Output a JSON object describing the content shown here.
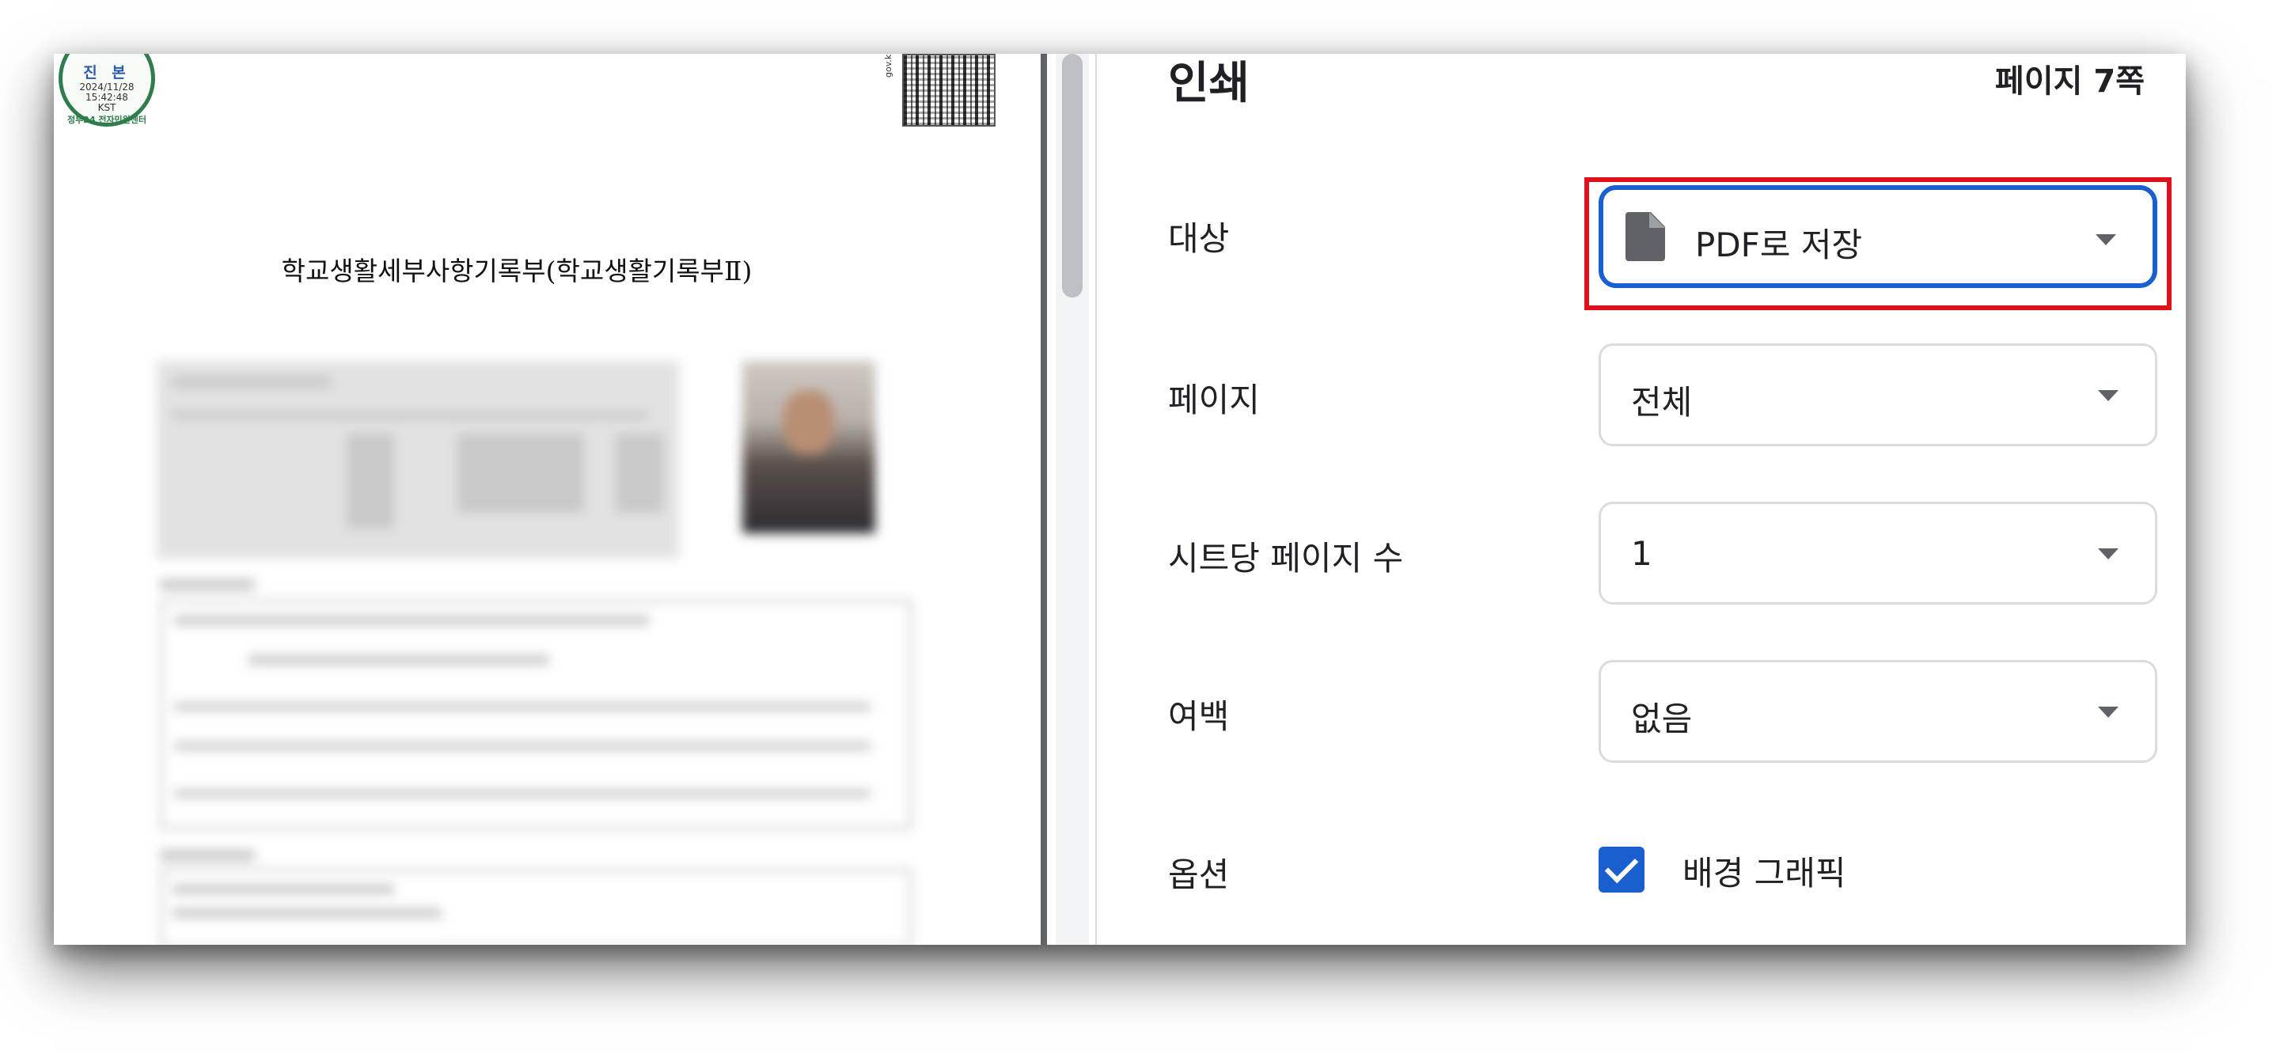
{
  "preview": {
    "seal": {
      "title": "진 본",
      "date": "2024/11/28",
      "time": "15:42:48",
      "tz": "KST",
      "org": "정부24 전자민원센터"
    },
    "qr_label": "gov.kr",
    "doc_title": "학교생활세부사항기록부(학교생활기록부Ⅱ)"
  },
  "settings": {
    "title": "인쇄",
    "page_count": "페이지 7쪽",
    "destination": {
      "label": "대상",
      "value": "PDF로 저장",
      "icon": "file-icon"
    },
    "pages": {
      "label": "페이지",
      "value": "전체"
    },
    "pages_per_sheet": {
      "label": "시트당 페이지 수",
      "value": "1"
    },
    "margins": {
      "label": "여백",
      "value": "없음"
    },
    "options": {
      "label": "옵션",
      "background_graphics": "배경 그래픽",
      "background_graphics_checked": true
    }
  },
  "colors": {
    "accent": "#1a5fd0",
    "highlight": "#e0101b",
    "text": "#202124",
    "border": "#dadce0"
  }
}
